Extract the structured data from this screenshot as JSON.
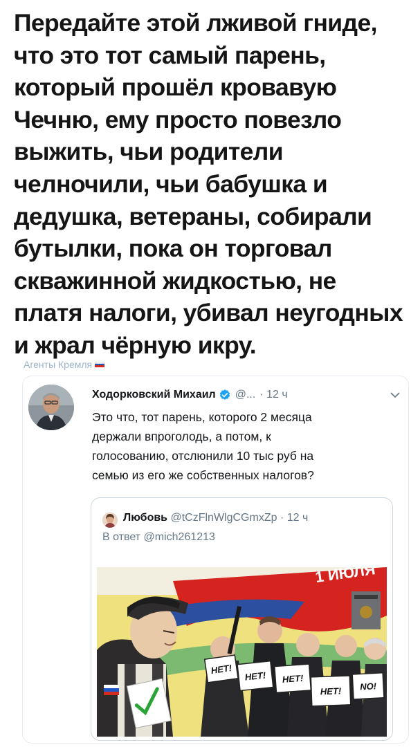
{
  "caption": {
    "lines": [
      "Передайте этой лживой гниде,",
      "что это тот самый парень,",
      "который прошёл кровавую",
      "Чечню, ему просто повезло",
      "выжить, чьи родители",
      "челночили, чьи бабушка и",
      "дедушка, ветераны, собирали",
      "бутылки, пока он торговал",
      "скважинной жидкостью, не",
      "платя налоги, убивал неугодных",
      "и жрал чёрную икру."
    ]
  },
  "watermark": {
    "text": "Агенты Кремля",
    "flag_colors": [
      "#ffffff",
      "#1c57c9",
      "#d52b1e"
    ]
  },
  "tweet": {
    "author": "Ходорковский Михаил",
    "handle": "@...",
    "time": "· 12 ч",
    "chevron_icon": "chevron-down-icon",
    "verified_icon": "verified-badge-icon",
    "accent_color": "#1da1f2",
    "text_lines": [
      "Это что, тот парень, которого 2 месяца",
      "держали впроголодь, а потом, к",
      "голосованию, отслюнили 10 тыс руб на",
      "семью из его же собственных налогов?"
    ],
    "quote": {
      "author": "Любовь",
      "handle": "@tCzFlnWlgCGmxZp",
      "time": "· 12 ч",
      "reply_prefix": "В ответ",
      "reply_to": "@mich261213",
      "poster": {
        "banner_text": "1 ИЮЛЯ",
        "signs": [
          "НЕТ!",
          "НЕТ!",
          "НЕТ!",
          "НЕТ!",
          "NO!"
        ]
      }
    }
  }
}
